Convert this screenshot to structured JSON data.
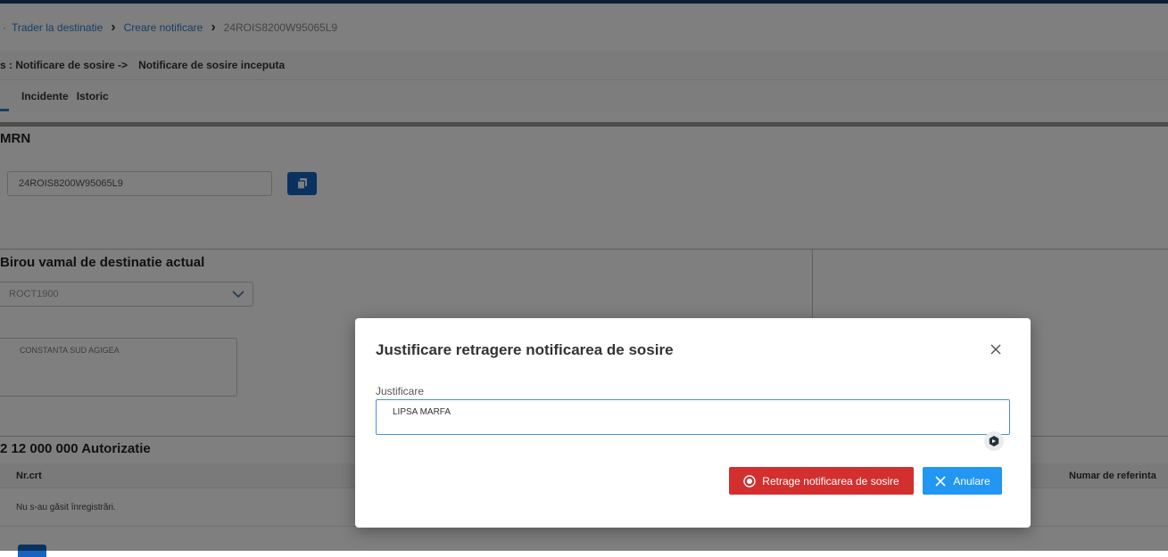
{
  "breadcrumb": {
    "items": [
      "Trader la destinatie",
      "Creare notificare"
    ],
    "current": "24ROIS8200W95065L9"
  },
  "status": {
    "label": "s : Notificare de sosire ->",
    "value": "Notificare de sosire inceputa"
  },
  "tabs": [
    "Incidente",
    "Istoric"
  ],
  "mrn": {
    "title": "MRN",
    "value": "24ROIS8200W95065L9",
    "copy_icon": "copy-icon"
  },
  "birou": {
    "title": "Birou vamal de destinatie actual",
    "code": "ROCT1900",
    "name": "CONSTANTA SUD AGIGEA"
  },
  "autorizatie": {
    "title": "2 12 000 000 Autorizatie",
    "columns": [
      "Nr.crt",
      "Numar de referinta"
    ],
    "empty_message": "Nu s-au găsit înregistrări."
  },
  "modal": {
    "title": "Justificare retragere notificarea de sosire",
    "field_label": "Justificare",
    "field_value": "LIPSA MARFA",
    "confirm_label": "Retrage notificarea de sosire",
    "cancel_label": "Anulare"
  },
  "colors": {
    "primary": "#1565c0",
    "link": "#2c7fc9",
    "danger": "#d32f2f",
    "cancel": "#2196f3"
  }
}
